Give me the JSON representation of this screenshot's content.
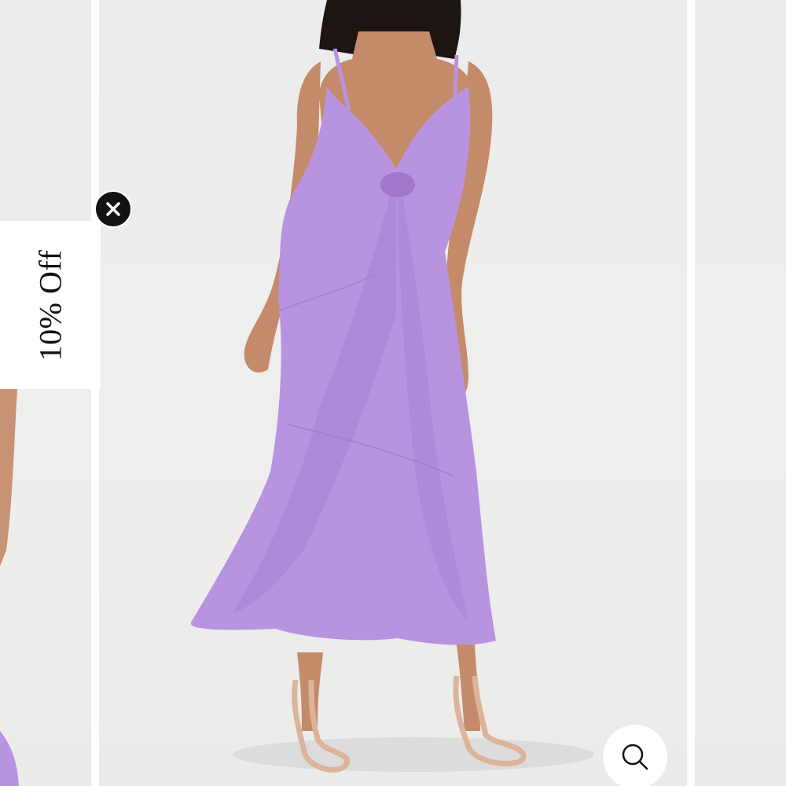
{
  "promo": {
    "label": "10% Off"
  },
  "controls": {
    "close_icon": "close-icon",
    "zoom_icon": "magnifier-icon"
  },
  "colors": {
    "dress": "#b894e0",
    "backdrop": "#ececec",
    "close_button": "#111111"
  }
}
